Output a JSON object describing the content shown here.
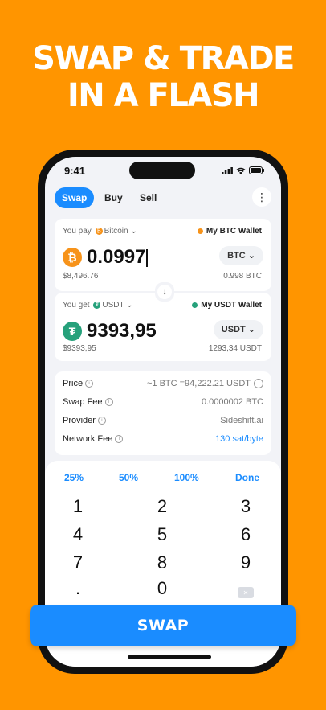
{
  "headline": {
    "line1": "SWAP & TRADE",
    "line2": "IN A FLASH"
  },
  "status": {
    "time": "9:41"
  },
  "tabs": [
    {
      "label": "Swap",
      "active": true
    },
    {
      "label": "Buy"
    },
    {
      "label": "Sell"
    }
  ],
  "pay": {
    "label": "You pay",
    "coin_name": "Bitcoin",
    "wallet": "My BTC Wallet",
    "amount": "0.0997",
    "fiat": "$8,496.76",
    "ticker": "BTC",
    "balance": "0.998 BTC"
  },
  "get": {
    "label": "You get",
    "coin_name": "USDT",
    "wallet": "My USDT Wallet",
    "amount": "9393,95",
    "fiat": "$9393,95",
    "ticker": "USDT",
    "balance": "1293,34 USDT"
  },
  "info": {
    "price_label": "Price",
    "price_value": "~1 BTC =94,222.21 USDT",
    "fee_label": "Swap Fee",
    "fee_value": "0.0000002 BTC",
    "provider_label": "Provider",
    "provider_value": "Sideshift.ai",
    "network_label": "Network Fee",
    "network_value": "130 sat/byte"
  },
  "keypad": {
    "pct25": "25%",
    "pct50": "50%",
    "pct100": "100%",
    "done": "Done",
    "k1": "1",
    "k2": "2",
    "k3": "3",
    "k4": "4",
    "k5": "5",
    "k6": "6",
    "k7": "7",
    "k8": "8",
    "k9": "9",
    "kdot": ".",
    "k0": "0"
  },
  "swap_button": "SWAP",
  "colors": {
    "background": "#FF9500",
    "accent": "#1A8CFF",
    "btc": "#F7931A",
    "usdt": "#26A17B"
  },
  "icons": [
    "signal-icon",
    "wifi-icon",
    "battery-icon",
    "more-vertical-icon",
    "chevron-down-icon",
    "bitcoin-icon",
    "tether-icon",
    "arrow-down-icon",
    "info-icon",
    "backspace-icon"
  ]
}
